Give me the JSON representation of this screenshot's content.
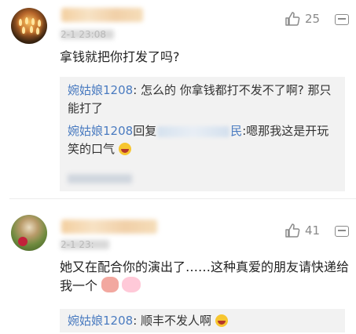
{
  "comments": [
    {
      "time_visible": "2-1 23:08",
      "likes": "25",
      "text": "拿钱就把你打发了吗?",
      "replies": [
        {
          "user": "婉姑娘1208",
          "text": ": 怎么的 你拿钱都打不发不了啊? 那只能打了"
        },
        {
          "user": "婉姑娘1208",
          "reply_word": "回复",
          "target_tail": "民",
          "text": ":嗯那我这是开玩笑的口气"
        }
      ]
    },
    {
      "time_visible": "2-1 23:",
      "likes": "41",
      "text": "她又在配合你的演出了……这种真爱的朋友请快递给我一个",
      "replies": [
        {
          "user": "婉姑娘1208",
          "text": ": 顺丰不发人啊"
        }
      ]
    }
  ],
  "icons": {
    "like": "thumbs-up-icon",
    "more": "more-options-icon",
    "laugh": "laughing-emoji-icon",
    "cheek": "blushing-emoji-icon",
    "pig": "pig-emoji-icon"
  },
  "colors": {
    "username": "#4a7bc0",
    "reply_background": "#f2f2f2",
    "meta_text": "#9a9a9a"
  }
}
